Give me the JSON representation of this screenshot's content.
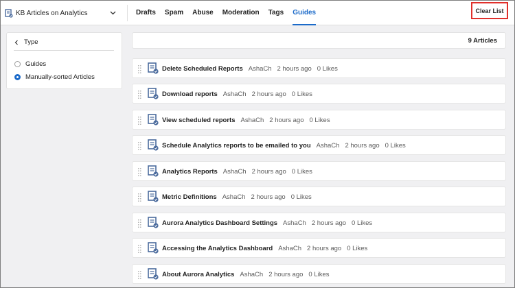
{
  "header": {
    "kb_title": "KB Articles on Analytics",
    "tabs": [
      {
        "label": "Drafts",
        "active": false
      },
      {
        "label": "Spam",
        "active": false
      },
      {
        "label": "Abuse",
        "active": false
      },
      {
        "label": "Moderation",
        "active": false
      },
      {
        "label": "Tags",
        "active": false
      },
      {
        "label": "Guides",
        "active": true
      }
    ],
    "clear_button": "Clear List"
  },
  "sidebar": {
    "section_title": "Type",
    "options": [
      {
        "label": "Guides",
        "selected": false
      },
      {
        "label": "Manually-sorted Articles",
        "selected": true
      }
    ]
  },
  "main": {
    "count_label": "9 Articles",
    "articles": [
      {
        "title": "Delete Scheduled Reports",
        "author": "AshaCh",
        "time": "2 hours ago",
        "likes": "0 Likes"
      },
      {
        "title": "Download reports",
        "author": "AshaCh",
        "time": "2 hours ago",
        "likes": "0 Likes"
      },
      {
        "title": "View scheduled reports",
        "author": "AshaCh",
        "time": "2 hours ago",
        "likes": "0 Likes"
      },
      {
        "title": "Schedule Analytics reports to be emailed to you",
        "author": "AshaCh",
        "time": "2 hours ago",
        "likes": "0 Likes"
      },
      {
        "title": "Analytics Reports",
        "author": "AshaCh",
        "time": "2 hours ago",
        "likes": "0 Likes"
      },
      {
        "title": "Metric Definitions",
        "author": "AshaCh",
        "time": "2 hours ago",
        "likes": "0 Likes"
      },
      {
        "title": "Aurora Analytics Dashboard Settings",
        "author": "AshaCh",
        "time": "2 hours ago",
        "likes": "0 Likes"
      },
      {
        "title": "Accessing the Analytics Dashboard",
        "author": "AshaCh",
        "time": "2 hours ago",
        "likes": "0 Likes"
      },
      {
        "title": "About Aurora Analytics",
        "author": "AshaCh",
        "time": "2 hours ago",
        "likes": "0 Likes"
      }
    ]
  },
  "colors": {
    "accent": "#1b6ac9",
    "highlight_border": "#e0302b",
    "icon": "#4a6a9c"
  },
  "icons": {
    "kb": "kb-articles-icon",
    "dropdown": "chevron-down-icon",
    "back": "chevron-left-icon",
    "drag": "drag-handle-icon",
    "article": "article-check-icon"
  }
}
